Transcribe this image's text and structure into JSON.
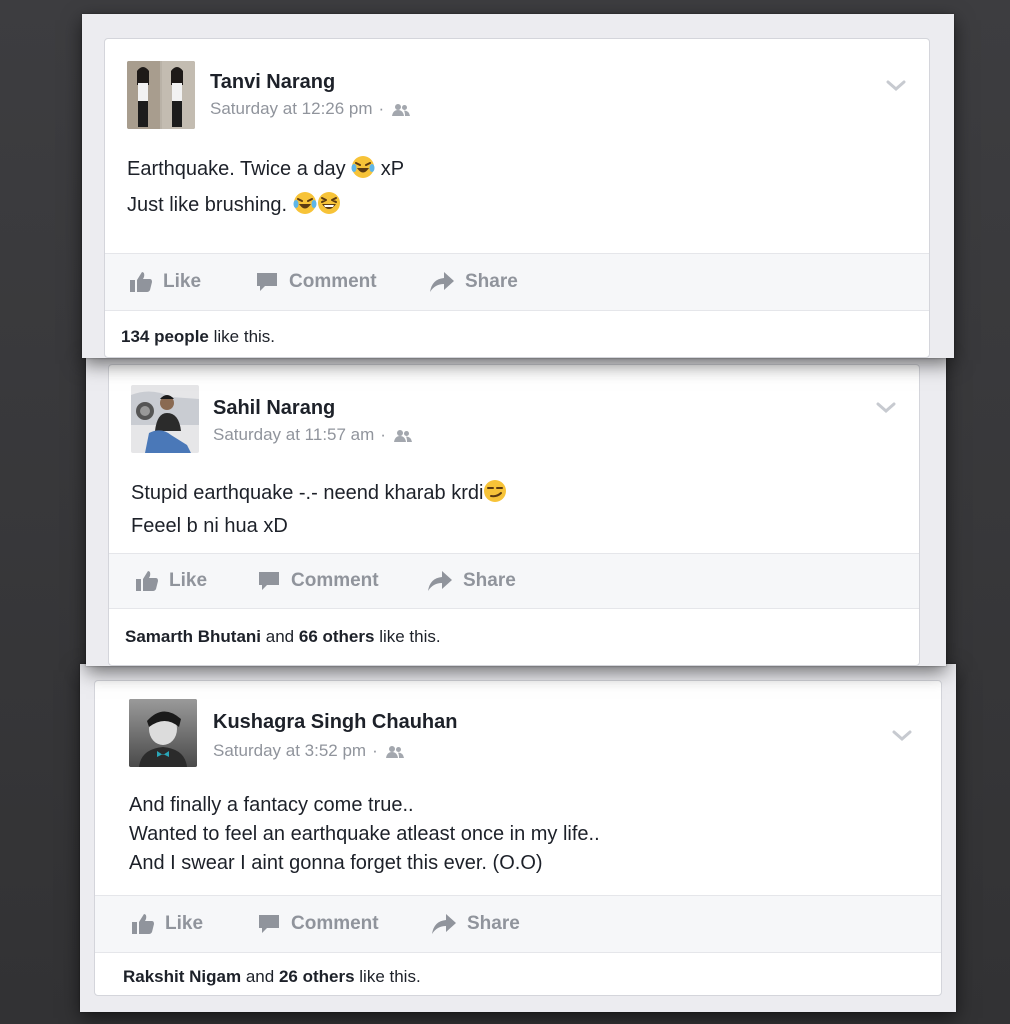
{
  "posts": [
    {
      "author": "Tanvi Narang",
      "time": "Saturday at 12:26 pm",
      "separator": "·",
      "lines": [
        "Earthquake. Twice a day",
        "xP",
        "Just like brushing."
      ],
      "actions": {
        "like": "Like",
        "comment": "Comment",
        "share": "Share"
      },
      "likes": {
        "bold1": "134 people",
        "rest": "like this."
      }
    },
    {
      "author": "Sahil Narang",
      "time": "Saturday at 11:57 am",
      "separator": "·",
      "lines": [
        "Stupid earthquake -.- neend kharab krdi",
        "Feeel b ni hua xD"
      ],
      "actions": {
        "like": "Like",
        "comment": "Comment",
        "share": "Share"
      },
      "likes": {
        "bold1": "Samarth Bhutani",
        "mid": "and",
        "bold2": "66 others",
        "rest": "like this."
      }
    },
    {
      "author": "Kushagra Singh Chauhan",
      "time": "Saturday at 3:52 pm",
      "separator": "·",
      "lines": [
        "And finally a fantacy come true..",
        "Wanted to feel an earthquake atleast once in my life..",
        "And I swear I aint gonna forget this ever.  (O.O)"
      ],
      "actions": {
        "like": "Like",
        "comment": "Comment",
        "share": "Share"
      },
      "likes": {
        "bold1": "Rakshit Nigam",
        "mid": "and",
        "bold2": "26 others",
        "rest": "like this."
      }
    }
  ],
  "icons": {
    "like": "thumbs-up-icon",
    "comment": "speech-bubble-icon",
    "share": "share-arrow-icon",
    "audience": "friends-icon",
    "menu": "chevron-down-icon",
    "emoji": [
      "laughing-tears-emoji",
      "grinning-squint-emoji",
      "smirk-emoji"
    ]
  },
  "colors": {
    "text": "#1d2129",
    "muted": "#90949c",
    "action_bar": "#f6f7f9",
    "background": "#3a3a3c"
  }
}
